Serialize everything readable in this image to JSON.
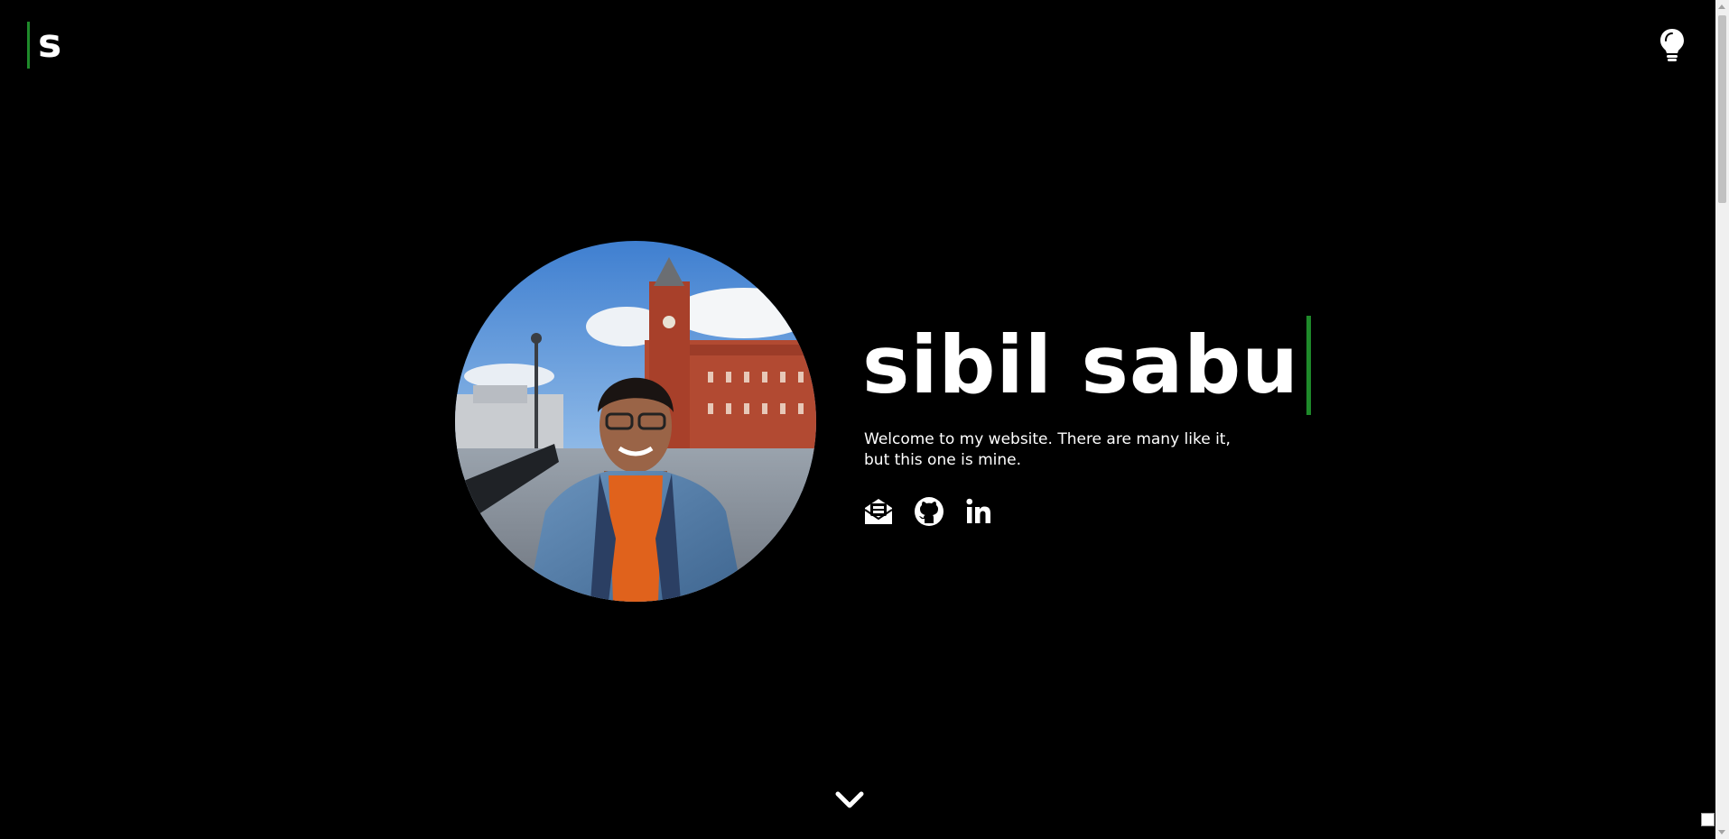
{
  "header": {
    "logo_letter": "s",
    "theme_toggle_icon": "lightbulb-icon"
  },
  "hero": {
    "name": "sibil sabu",
    "tagline": "Welcome to my website. There are many like it, but this one is mine.",
    "avatar_alt": "profile-photo",
    "socials": [
      {
        "icon": "email-icon"
      },
      {
        "icon": "github-icon"
      },
      {
        "icon": "linkedin-icon"
      }
    ],
    "scroll_icon": "chevron-down-icon"
  },
  "colors": {
    "background": "#000000",
    "text": "#ffffff",
    "accent": "#1e8a2a"
  }
}
